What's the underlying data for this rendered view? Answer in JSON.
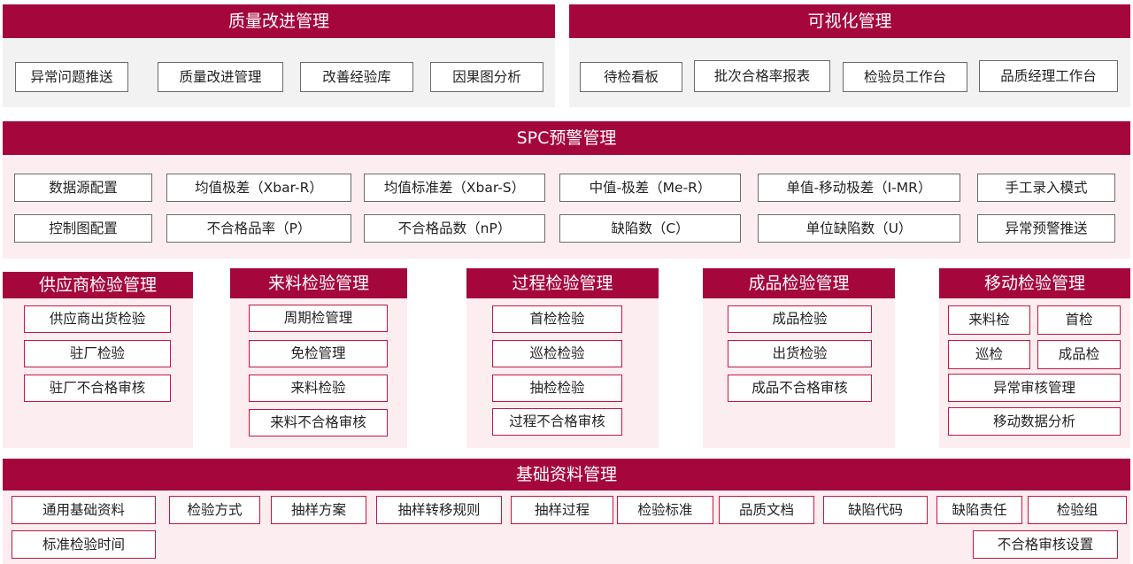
{
  "colors": {
    "primary": "#a5073d",
    "panel_gray": "#f2f2f2",
    "panel_pink": "#fcedf1",
    "box_border_red": "#c6163f"
  },
  "quality": {
    "title": "质量改进管理",
    "items": [
      "异常问题推送",
      "质量改进管理",
      "改善经验库",
      "因果图分析"
    ]
  },
  "visual": {
    "title": "可视化管理",
    "items": [
      "待检看板",
      "批次合格率报表",
      "检验员工作台",
      "品质经理工作台"
    ]
  },
  "spc": {
    "title": "SPC预警管理",
    "row1": [
      "数据源配置",
      "均值极差（Xbar-R）",
      "均值标准差（Xbar-S）",
      "中值-极差（Me-R）",
      "单值-移动极差（I-MR）",
      "手工录入模式"
    ],
    "row2": [
      "控制图配置",
      "不合格品率（P）",
      "不合格品数（nP）",
      "缺陷数（C）",
      "单位缺陷数（U）",
      "异常预警推送"
    ]
  },
  "columns": [
    {
      "title": "供应商检验管理",
      "items": [
        "供应商出货检验",
        "驻厂检验",
        "驻厂不合格审核"
      ]
    },
    {
      "title": "来料检验管理",
      "items": [
        "周期检管理",
        "免检管理",
        "来料检验",
        "来料不合格审核"
      ]
    },
    {
      "title": "过程检验管理",
      "items": [
        "首检检验",
        "巡检检验",
        "抽检检验",
        "过程不合格审核"
      ]
    },
    {
      "title": "成品检验管理",
      "items": [
        "成品检验",
        "出货检验",
        "成品不合格审核"
      ]
    },
    {
      "title": "移动检验管理",
      "items": [
        "来料检",
        "首检",
        "巡检",
        "成品检",
        "异常审核管理",
        "移动数据分析"
      ]
    }
  ],
  "base": {
    "title": "基础资料管理",
    "row1": [
      "通用基础资料",
      "检验方式",
      "抽样方案",
      "抽样转移规则",
      "抽样过程",
      "检验标准",
      "品质文档",
      "缺陷代码",
      "缺陷责任",
      "检验组"
    ],
    "row2": [
      "标准检验时间",
      "不合格审核设置"
    ]
  }
}
